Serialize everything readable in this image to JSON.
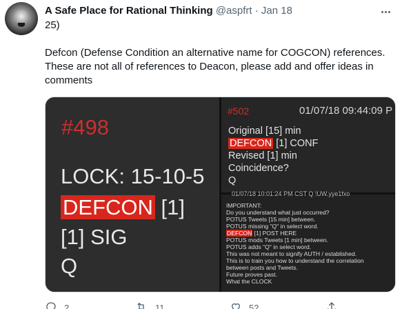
{
  "author": {
    "name": "A Safe Place for Rational Thinking",
    "handle": "@aspfrt",
    "separator": "·",
    "date": "Jan 18"
  },
  "tweet": {
    "line1": "25)",
    "line2": "Defcon (Defense Condition an alternative name for COGCON) references.",
    "line3": "These are not all of references to Deacon, please add and offer ideas in",
    "line4": "comments"
  },
  "media": {
    "left": {
      "post": "#498",
      "lock": "LOCK: 15-10-5",
      "defcon": "DEFCON",
      "defcon_rest": " [1]",
      "sig": "[1] SIG",
      "q": "Q"
    },
    "right_top": {
      "post": "#502",
      "timestamp": "01/07/18 09:44:09 P",
      "line1": "Original [15] min",
      "defcon": "DEFCON",
      "defcon_rest": " [1] CONF",
      "line3": "Revised [1] min",
      "line4": "Coincidence?",
      "line5": "Q"
    },
    "right_bottom": {
      "header": "01/07/18 10:01:24 PM CST Q !UW.yye1fxo",
      "lines": [
        "IMPORTANT:",
        "Do you understand what just occurred?",
        "POTUS Tweets [15 min] between.",
        "POTUS missing \"Q\" in select word.",
        "POTUS mods Tweets [1 min] between.",
        "POTUS adds \"Q\" in select word.",
        "This was not meant to signify AUTH / established.",
        "This is to train you how to understand the correlation",
        "between posts and Tweets.",
        "Future proves past.",
        "What the CLOCK"
      ],
      "defcon": "DEFCON",
      "defcon_rest": " [1] POST HERE"
    }
  },
  "actions": {
    "reply_count": "2",
    "retweet_count": "11",
    "like_count": "52"
  },
  "icons": [
    "more-icon",
    "reply-icon",
    "retweet-icon",
    "like-icon",
    "share-icon"
  ],
  "colors": {
    "highlight_red": "#d9261c",
    "post_number_red": "#c9302c",
    "muted_text": "#536471"
  }
}
